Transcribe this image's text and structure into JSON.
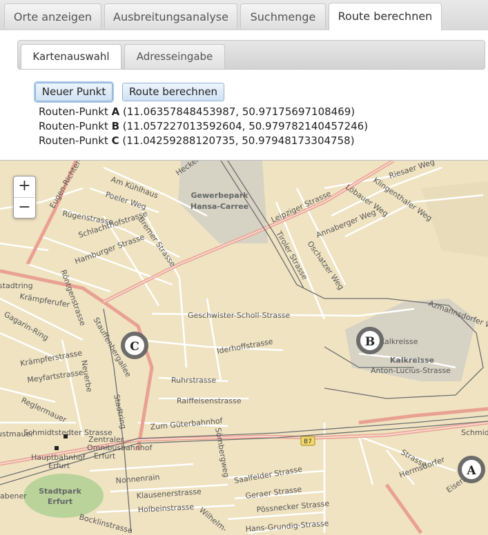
{
  "top_tabs": [
    {
      "label": "Orte anzeigen"
    },
    {
      "label": "Ausbreitungsanalyse"
    },
    {
      "label": "Suchmenge"
    },
    {
      "label": "Route berechnen"
    }
  ],
  "inner_tabs": [
    {
      "label": "Kartenauswahl"
    },
    {
      "label": "Adresseingabe"
    }
  ],
  "buttons": {
    "new_point": "Neuer Punkt",
    "calc_route": "Route berechnen"
  },
  "route_points": [
    {
      "prefix": "Routen-Punkt ",
      "letter": "A",
      "coords": " (11.06357848453987, 50.97175697108469)"
    },
    {
      "prefix": "Routen-Punkt ",
      "letter": "B",
      "coords": " (11.057227013592604, 50.979782140457246)"
    },
    {
      "prefix": "Routen-Punkt ",
      "letter": "C",
      "coords": " (11.04259288120735, 50.97948173304758)"
    }
  ],
  "map": {
    "zoom_in": "+",
    "zoom_out": "−",
    "markers": [
      "A",
      "B",
      "C"
    ],
    "areas": {
      "gewerbepark_1": "Gewerbepark",
      "gewerbepark_2": "Hansa-Carree",
      "kalkreisse": "Kalkreisse",
      "stadtpark_1": "Stadtpark",
      "stadtpark_2": "Erfurt"
    },
    "streets": {
      "s1": "Am Kühlhaus",
      "s2": "Poeler Weg",
      "s3": "Rügenstrasse",
      "s4": "Schlachthofstrasse",
      "s5": "Bremer Strasse",
      "s6": "Hamburger Strasse",
      "s7": "Leipziger Strasse",
      "s8": "Tiroler Strasse",
      "s9": "Oschatzer Weg",
      "s10": "Annaberger Weg",
      "s11": "Löbauer Weg",
      "s12": "Klingenthaler Weg",
      "s13": "Riesaer Weg",
      "s14": "Azmannsdorfer Weg",
      "s15": "Geschwister-Scholl-Strasse",
      "s16": "Iderhoffstrasse",
      "s17": "Ruhrstrasse",
      "s18": "Raiffeisenstrasse",
      "s19": "Zum Güterbahnhof",
      "s20": "Sörnbergweg",
      "s21": "Anton-Lucius-Strasse",
      "s22": "Kalkreisse",
      "s23": "Stauffenbergallee",
      "s24": "Stadtring",
      "s25": "Röntgenstrasse",
      "s26": "Eugen-Richter-Strasse",
      "s27": "Krämpferufer",
      "s28": "Gagarin-Ring",
      "s29": "Krämpferstrasse",
      "s30": "Meyfartstrasse",
      "s31": "Reglermauer",
      "s32": "Schmidtstedter Strasse",
      "s33": "Zentraler",
      "s34": "Omnibusbahnhof",
      "s35": "Erfurt",
      "s36": "Hauptbahnhof",
      "s37": "Erfurt",
      "s38": "Nonnenrain",
      "s39": "Klausenerstrasse",
      "s40": "Holbeinstrasse",
      "s41": "Wilhelm-",
      "s42": "Saalfelder Strasse",
      "s43": "Geraer Strasse",
      "s44": "Pössnecker Strasse",
      "s45": "Hans-Grundig-Strasse",
      "s46": "Bocklinstrasse",
      "s47": "Hermsdorfer",
      "s48": "Eisenberger",
      "s49": "Schmidt",
      "s50": "Heckerstieg",
      "s51": "Neuerbe",
      "s52": "B7",
      "s53": "stadtring",
      "s54": "ustmauer",
      "s55": "Strasse",
      "s56": "abener",
      "s57": "Strasse",
      "s58": "Weg",
      "s59": "Strasse",
      "s60": "Strasse",
      "s61": "Krämpferstrasse"
    }
  }
}
